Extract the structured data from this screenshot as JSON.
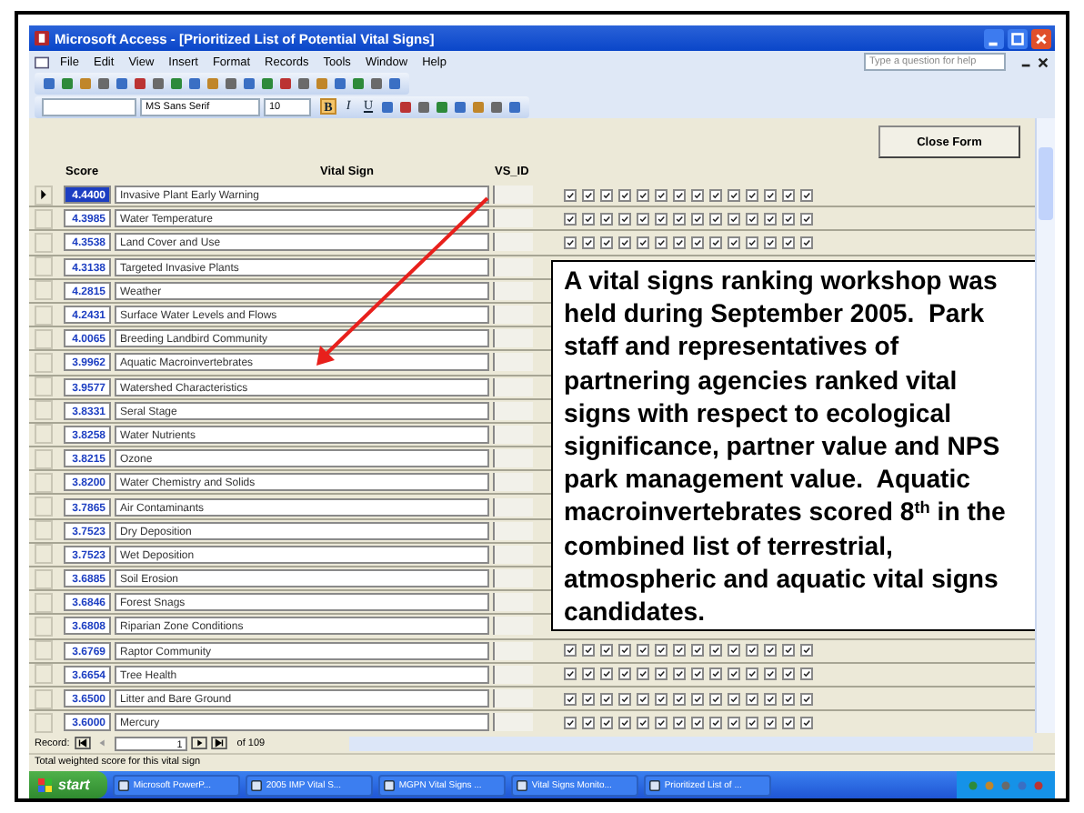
{
  "window": {
    "title": "Microsoft Access - [Prioritized List of Potential Vital Signs]"
  },
  "menu": [
    "File",
    "Edit",
    "View",
    "Insert",
    "Format",
    "Records",
    "Tools",
    "Window",
    "Help"
  ],
  "help_box": {
    "placeholder": "Type a question for help"
  },
  "formatting": {
    "font": "MS Sans Serif",
    "size": "10",
    "styles": [
      {
        "label": "B",
        "selected": true
      },
      {
        "label": "I",
        "selected": false
      },
      {
        "label": "U",
        "selected": false
      }
    ]
  },
  "form": {
    "close_button": "Close Form",
    "columns": [
      "Score",
      "Vital Sign",
      "VS_ID"
    ],
    "rows": [
      {
        "score": "4.4400",
        "name": "Invasive Plant Early Warning",
        "selected": true,
        "checks": [
          true,
          true,
          true,
          true,
          true,
          true,
          true,
          true,
          true,
          true,
          true,
          true,
          true,
          true
        ]
      },
      {
        "score": "4.3985",
        "name": "Water Temperature",
        "selected": false,
        "checks": [
          true,
          true,
          true,
          true,
          true,
          true,
          true,
          true,
          true,
          true,
          true,
          true,
          true,
          true
        ]
      },
      {
        "score": "4.3538",
        "name": "Land Cover and Use",
        "selected": false,
        "checks": [
          true,
          true,
          true,
          true,
          true,
          true,
          true,
          true,
          true,
          true,
          true,
          true,
          true,
          true
        ]
      },
      {
        "score": "4.3138",
        "name": "Targeted Invasive Plants",
        "selected": false
      },
      {
        "score": "4.2815",
        "name": "Weather",
        "selected": false
      },
      {
        "score": "4.2431",
        "name": "Surface Water Levels and Flows",
        "selected": false
      },
      {
        "score": "4.0065",
        "name": "Breeding Landbird Community",
        "selected": false
      },
      {
        "score": "3.9962",
        "name": "Aquatic Macroinvertebrates",
        "selected": false
      },
      {
        "score": "3.9577",
        "name": "Watershed Characteristics",
        "selected": false
      },
      {
        "score": "3.8331",
        "name": "Seral Stage",
        "selected": false
      },
      {
        "score": "3.8258",
        "name": "Water Nutrients",
        "selected": false
      },
      {
        "score": "3.8215",
        "name": "Ozone",
        "selected": false
      },
      {
        "score": "3.8200",
        "name": "Water Chemistry and Solids",
        "selected": false
      },
      {
        "score": "3.7865",
        "name": "Air Contaminants",
        "selected": false
      },
      {
        "score": "3.7523",
        "name": "Dry Deposition",
        "selected": false
      },
      {
        "score": "3.7523",
        "name": "Wet Deposition",
        "selected": false
      },
      {
        "score": "3.6885",
        "name": "Soil Erosion",
        "selected": false
      },
      {
        "score": "3.6846",
        "name": "Forest Snags",
        "selected": false
      },
      {
        "score": "3.6808",
        "name": "Riparian Zone Conditions",
        "selected": false
      },
      {
        "score": "3.6769",
        "name": "Raptor Community",
        "selected": false,
        "checks": [
          true,
          true,
          true,
          true,
          true,
          true,
          true,
          true,
          true,
          true,
          true,
          true,
          true,
          true
        ]
      },
      {
        "score": "3.6654",
        "name": "Tree Health",
        "selected": false,
        "checks": [
          true,
          true,
          true,
          true,
          true,
          true,
          true,
          true,
          true,
          true,
          true,
          true,
          true,
          true
        ]
      },
      {
        "score": "3.6500",
        "name": "Litter and Bare Ground",
        "selected": false,
        "checks": [
          true,
          true,
          true,
          true,
          true,
          true,
          true,
          true,
          true,
          true,
          true,
          true,
          true,
          true
        ]
      },
      {
        "score": "3.6000",
        "name": "Mercury",
        "selected": false,
        "checks": [
          true,
          true,
          true,
          true,
          true,
          true,
          true,
          true,
          true,
          true,
          true,
          true,
          true,
          true
        ]
      }
    ]
  },
  "record_nav": {
    "label": "Record:",
    "current": "1",
    "total": "of 109"
  },
  "status_bar": "Total weighted score for this vital sign",
  "taskbar": {
    "start": "start",
    "items": [
      "Microsoft PowerP...",
      "2005 IMP Vital S...",
      "MGPN Vital Signs ...",
      "Vital Signs Monito...",
      "Prioritized List of ..."
    ]
  },
  "callout": "A vital signs ranking workshop was held during September 2005.  Park staff and representatives of partnering agencies ranked vital signs with respect to ecological significance, partner value and NPS park management value.  Aquatic macroinvertebrates scored 8$^{th}$ in the combined list of terrestrial, atmospheric and aquatic vital signs candidates."
}
